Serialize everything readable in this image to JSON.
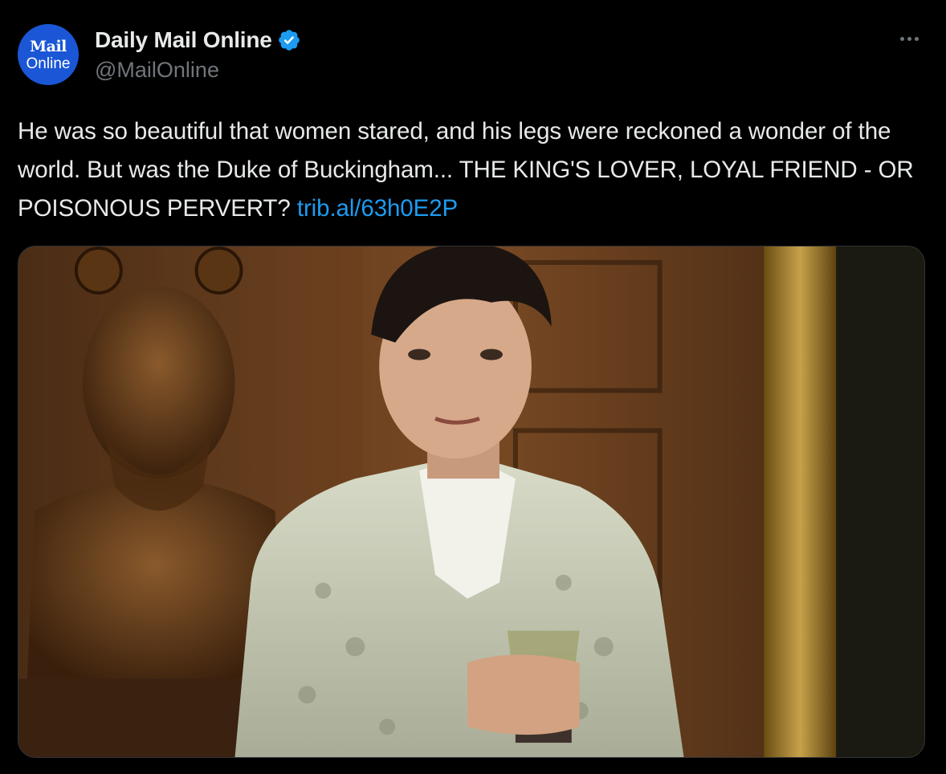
{
  "account": {
    "display_name": "Daily Mail Online",
    "handle": "@MailOnline",
    "avatar_logo_top": "Mail",
    "avatar_logo_bottom": "Online",
    "verified": true,
    "avatar_color": "#1a56d6",
    "verified_color": "#1d9bf0"
  },
  "menu": {
    "icon": "more-horizontal-icon"
  },
  "tweet": {
    "text": "He was so beautiful that women stared, and his legs were reckoned a wonder of the world. But was the Duke of Buckingham... THE KING'S LOVER, LOYAL FRIEND - OR POISONOUS PERVERT?",
    "link": "trib.al/63h0E2P",
    "link_color": "#1d9bf0"
  },
  "media": {
    "type": "photo"
  }
}
